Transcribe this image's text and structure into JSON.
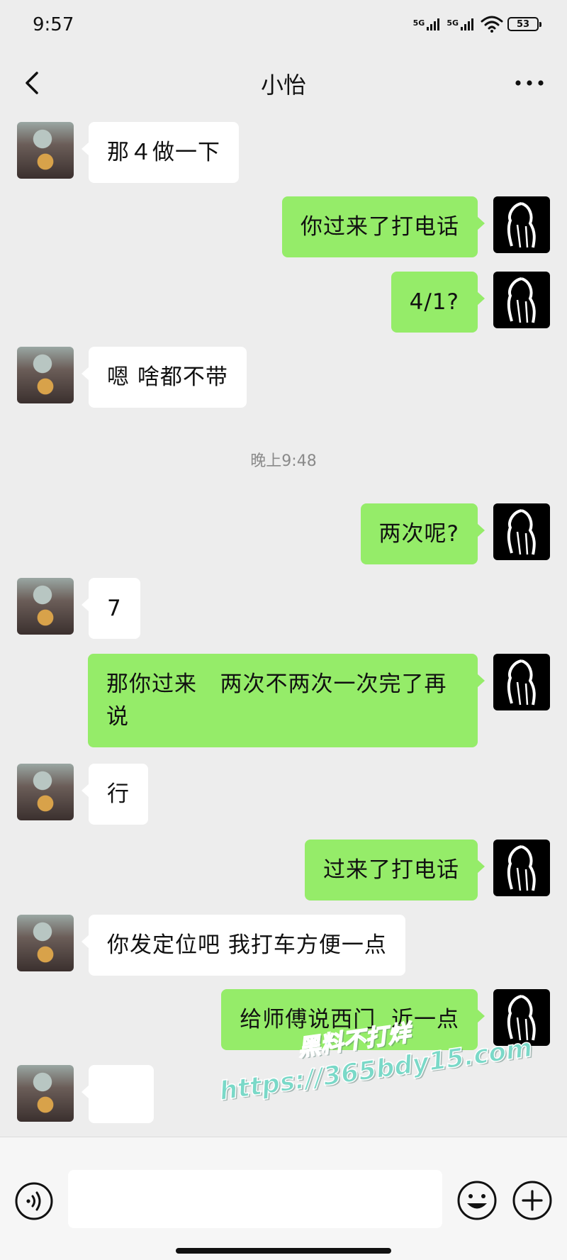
{
  "status_bar": {
    "time": "9:57",
    "network_1": "5G",
    "network_2": "5G",
    "battery": "53"
  },
  "header": {
    "title": "小怡",
    "back_icon": "chevron-left-icon",
    "more_icon": "more-horizontal-icon"
  },
  "messages": [
    {
      "side": "in",
      "text": "那４做一下"
    },
    {
      "side": "out",
      "text": "你过来了打电话"
    },
    {
      "side": "out",
      "text": "4/1?"
    },
    {
      "side": "in",
      "text": "嗯 啥都不带"
    },
    {
      "type": "time",
      "text": "晚上9:48"
    },
    {
      "side": "out",
      "text": "两次呢?"
    },
    {
      "side": "in",
      "text": "7"
    },
    {
      "side": "out",
      "text": "那你过来   两次不两次一次完了再说"
    },
    {
      "side": "in",
      "text": "行"
    },
    {
      "side": "out",
      "text": "过来了打电话"
    },
    {
      "side": "in",
      "text": "你发定位吧 我打车方便一点"
    },
    {
      "side": "out",
      "text": "给师傅说西门  近一点"
    },
    {
      "side": "in",
      "text": "",
      "emoji": "ok-hand-emoji"
    },
    {
      "side": "in",
      "text": "",
      "partial": true
    }
  ],
  "watermark": {
    "line1": "黑料不打烊",
    "line2": "https://365bdy15.com"
  },
  "input_bar": {
    "voice_icon": "voice-icon",
    "emoji_icon": "emoji-icon",
    "plus_icon": "plus-circle-icon",
    "placeholder": ""
  },
  "colors": {
    "background": "#ededed",
    "incoming_bubble": "#ffffff",
    "outgoing_bubble": "#95ec69",
    "watermark": "#7ad9c8"
  }
}
